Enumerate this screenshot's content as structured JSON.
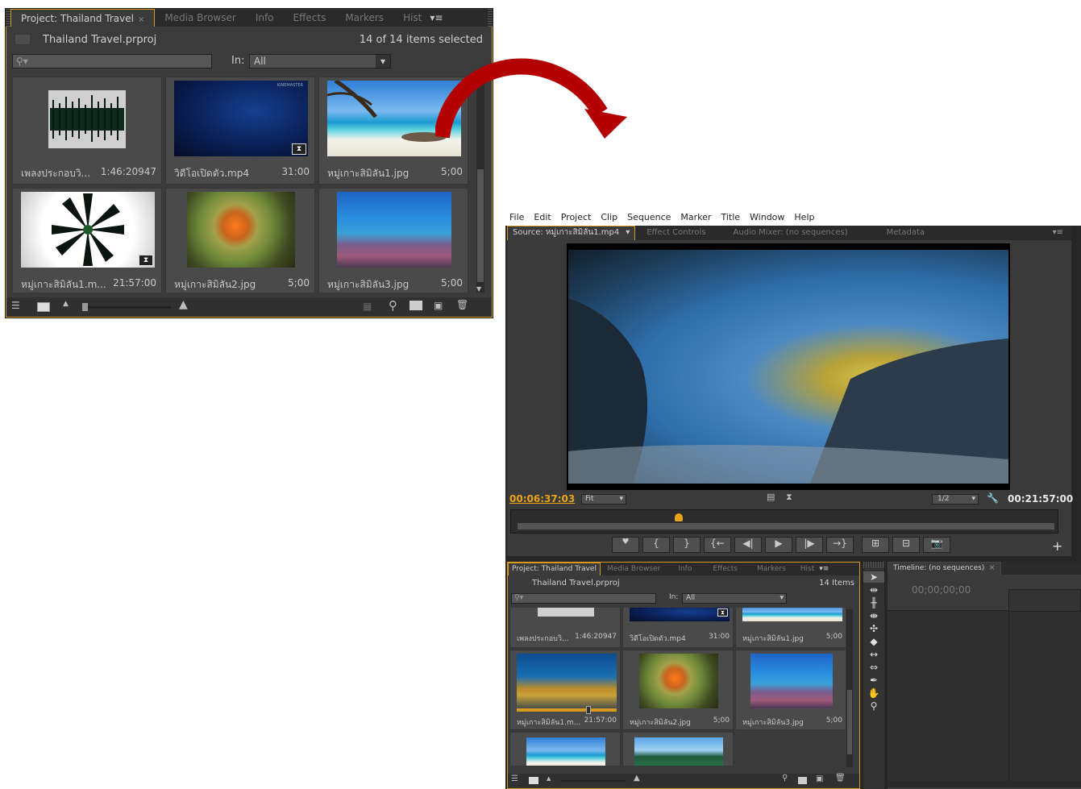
{
  "small_project_panel": {
    "tabs": [
      {
        "label": "Project: Thailand Travel",
        "active": true,
        "close": "×"
      },
      {
        "label": "Media Browser"
      },
      {
        "label": "Info"
      },
      {
        "label": "Effects"
      },
      {
        "label": "Markers"
      },
      {
        "label": "Hist"
      }
    ],
    "menu_icon": "menu-lines-icon",
    "project_file": "Thailand Travel.prproj",
    "selection_status": "14 of 14 items selected",
    "search_placeholder": "",
    "in_label": "In:",
    "in_value": "All",
    "items": [
      {
        "name": "เพลงประกอบวิ...",
        "duration": "1:46:20947",
        "type": "audio",
        "badge": ""
      },
      {
        "name": "วิดีโอเปิดตัว.mp4",
        "duration": "31:00",
        "type": "video",
        "badge": "⧗",
        "logo": "KINEMASTER"
      },
      {
        "name": "หมู่เกาะสิมิลัน1.jpg",
        "duration": "5;00",
        "type": "image",
        "badge": ""
      },
      {
        "name": "หมู่เกาะสิมิลัน1.m...",
        "duration": "21:57:00",
        "type": "video",
        "badge": "⧗"
      },
      {
        "name": "หมู่เกาะสิมิลัน2.jpg",
        "duration": "5;00",
        "type": "image",
        "badge": ""
      },
      {
        "name": "หมู่เกาะสิมิลัน3.jpg",
        "duration": "5;00",
        "type": "image",
        "badge": ""
      }
    ]
  },
  "app": {
    "menu": [
      "File",
      "Edit",
      "Project",
      "Clip",
      "Sequence",
      "Marker",
      "Title",
      "Window",
      "Help"
    ],
    "source_tabs": [
      {
        "label": "Source: หมู่เกาะสิมิลัน1.mp4",
        "active": true
      },
      {
        "label": "Effect Controls"
      },
      {
        "label": "Audio Mixer: (no sequences)"
      },
      {
        "label": "Metadata"
      }
    ],
    "timecode_in": "00:06:37:03",
    "fit_label": "Fit",
    "resolution": "1/2",
    "timecode_out": "00:21:57:00",
    "playhead_fraction": 0.3
  },
  "big_project_panel": {
    "tabs": [
      {
        "label": "Project: Thailand Travel",
        "active": true
      },
      {
        "label": "Media Browser"
      },
      {
        "label": "Info"
      },
      {
        "label": "Effects"
      },
      {
        "label": "Markers"
      },
      {
        "label": "Hist"
      }
    ],
    "project_file": "Thailand Travel.prproj",
    "item_count": "14 Items",
    "in_label": "In:",
    "in_value": "All",
    "items": [
      {
        "name": "เพลงประกอบวิ...",
        "duration": "1:46:20947"
      },
      {
        "name": "วิดีโอเปิดตัว.mp4",
        "duration": "31:00"
      },
      {
        "name": "หมู่เกาะสิมิลัน1.jpg",
        "duration": "5;00"
      },
      {
        "name": "หมู่เกาะสิมิลัน1.m...",
        "duration": "21:57:00"
      },
      {
        "name": "หมู่เกาะสิมิลัน2.jpg",
        "duration": "5;00"
      },
      {
        "name": "หมู่เกาะสิมิลัน3.jpg",
        "duration": "5;00"
      }
    ]
  },
  "timeline": {
    "tab_label": "Timeline: (no sequences)",
    "timecode": "00;00;00;00"
  },
  "colors": {
    "accent": "#d59a1e",
    "timecode": "#e8a318",
    "arrow": "#b30000"
  }
}
